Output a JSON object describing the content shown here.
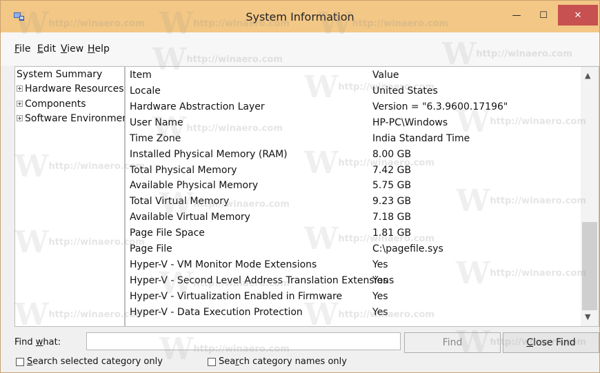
{
  "window": {
    "title": "System Information"
  },
  "titlebar_buttons": {
    "minimize": "—",
    "maximize": "☐",
    "close": "✕"
  },
  "menu": [
    {
      "label": "File",
      "ul": "F",
      "rest": "ile"
    },
    {
      "label": "Edit",
      "ul": "E",
      "rest": "dit"
    },
    {
      "label": "View",
      "ul": "V",
      "rest": "iew"
    },
    {
      "label": "Help",
      "ul": "H",
      "rest": "elp"
    }
  ],
  "tree": {
    "root": "System Summary",
    "children": [
      "Hardware Resources",
      "Components",
      "Software Environment"
    ]
  },
  "table": {
    "headers": {
      "item": "Item",
      "value": "Value"
    },
    "rows": [
      {
        "item": "Locale",
        "value": "United States"
      },
      {
        "item": "Hardware Abstraction Layer",
        "value": "Version = \"6.3.9600.17196\""
      },
      {
        "item": "User Name",
        "value": "HP-PC\\Windows"
      },
      {
        "item": "Time Zone",
        "value": "India Standard Time"
      },
      {
        "item": "Installed Physical Memory (RAM)",
        "value": "8.00 GB"
      },
      {
        "item": "Total Physical Memory",
        "value": "7.42 GB"
      },
      {
        "item": "Available Physical Memory",
        "value": "5.75 GB"
      },
      {
        "item": "Total Virtual Memory",
        "value": "9.23 GB"
      },
      {
        "item": "Available Virtual Memory",
        "value": "7.18 GB"
      },
      {
        "item": "Page File Space",
        "value": "1.81 GB"
      },
      {
        "item": "Page File",
        "value": "C:\\pagefile.sys"
      },
      {
        "item": "Hyper-V - VM Monitor Mode Extensions",
        "value": "Yes"
      },
      {
        "item": "Hyper-V - Second Level Address Translation Extensions",
        "value": "Yes"
      },
      {
        "item": "Hyper-V - Virtualization Enabled in Firmware",
        "value": "Yes"
      },
      {
        "item": "Hyper-V - Data Execution Protection",
        "value": "Yes"
      }
    ]
  },
  "find": {
    "label_ul": "w",
    "label_pre": "Find ",
    "label_post": "hat:",
    "value": "",
    "find_button": "Find",
    "close_find_ul": "C",
    "close_find_rest": "lose Find"
  },
  "options": {
    "search_selected_ul": "S",
    "search_selected_rest": "earch selected category only",
    "search_names_pre": "Sea",
    "search_names_ul": "r",
    "search_names_post": "ch category names only"
  },
  "watermark": {
    "letter": "W",
    "text": "http://winaero.com"
  },
  "colors": {
    "titlebar": "#f3c785",
    "close": "#c75050"
  }
}
